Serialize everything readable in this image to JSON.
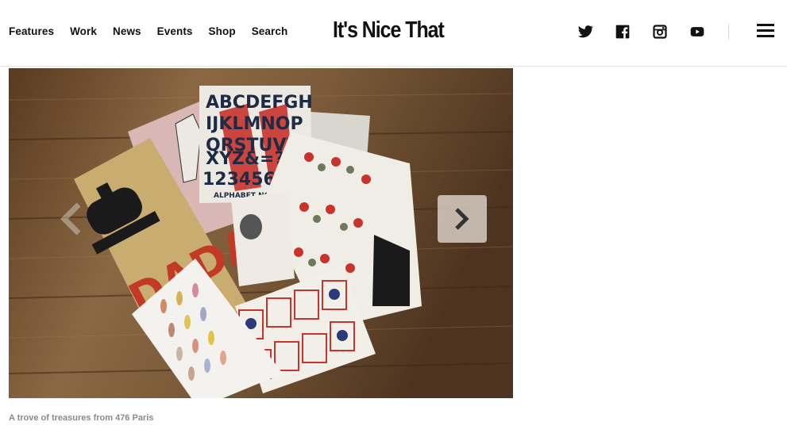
{
  "nav": {
    "items": [
      {
        "label": "Features"
      },
      {
        "label": "Work"
      },
      {
        "label": "News"
      },
      {
        "label": "Events"
      },
      {
        "label": "Shop"
      },
      {
        "label": "Search"
      }
    ]
  },
  "logo": {
    "text": "It's Nice That"
  },
  "social": {
    "icons": [
      "twitter-icon",
      "facebook-icon",
      "instagram-icon",
      "youtube-icon"
    ]
  },
  "menu": {
    "icon": "hamburger-menu-icon"
  },
  "hero": {
    "poster_letters": [
      "ABCDEFGH",
      "IJKLMNOP",
      "QRSTUVW",
      "XYZ&=?",
      "1234567"
    ],
    "poster_footer": "ALPHABET NORD",
    "dada_text": "DADA",
    "next_icon": "chevron-right-icon",
    "prev_icon": "chevron-left-icon"
  },
  "caption": {
    "text": "A trove of treasures from 476 Paris"
  },
  "colors": {
    "text": "#111111",
    "caption": "#8a8a8a",
    "divider": "#e6e6e6"
  }
}
